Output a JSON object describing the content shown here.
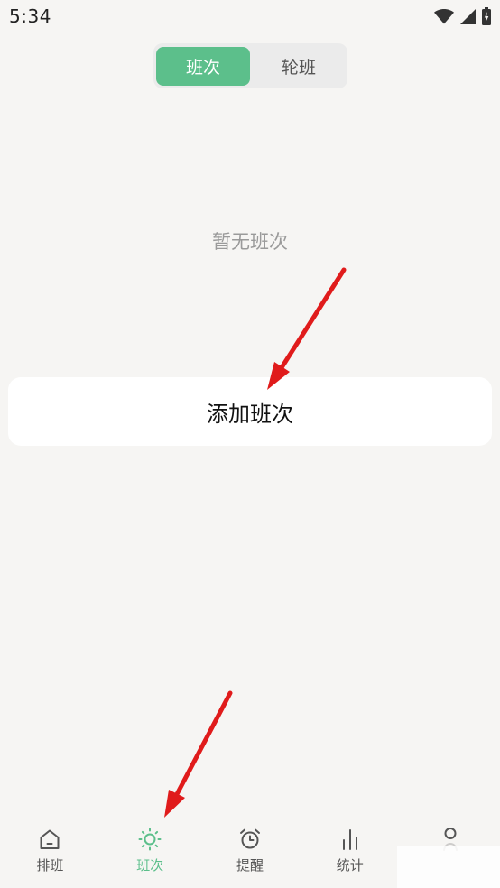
{
  "status_bar": {
    "time": "5:34",
    "icons": [
      "wifi-icon",
      "cell-signal-icon",
      "battery-charging-icon"
    ]
  },
  "segmented_control": {
    "tabs": [
      {
        "label": "班次",
        "selected": true
      },
      {
        "label": "轮班",
        "selected": false
      }
    ]
  },
  "empty_state": {
    "message": "暂无班次"
  },
  "add_button": {
    "label": "添加班次"
  },
  "bottom_nav": {
    "items": [
      {
        "label": "排班",
        "icon": "home-icon",
        "active": false
      },
      {
        "label": "班次",
        "icon": "sun-icon",
        "active": true
      },
      {
        "label": "提醒",
        "icon": "alarm-clock-icon",
        "active": false
      },
      {
        "label": "统计",
        "icon": "bar-chart-icon",
        "active": false
      },
      {
        "icon": "person-icon",
        "active": false
      }
    ]
  },
  "annotations": {
    "icon": "red-arrow-icon"
  },
  "colors": {
    "background": "#F6F5F3",
    "accent": "#5CBF8B",
    "annotation": "#E01B1B",
    "text": "#111111",
    "muted_text": "#9A9A9A"
  }
}
